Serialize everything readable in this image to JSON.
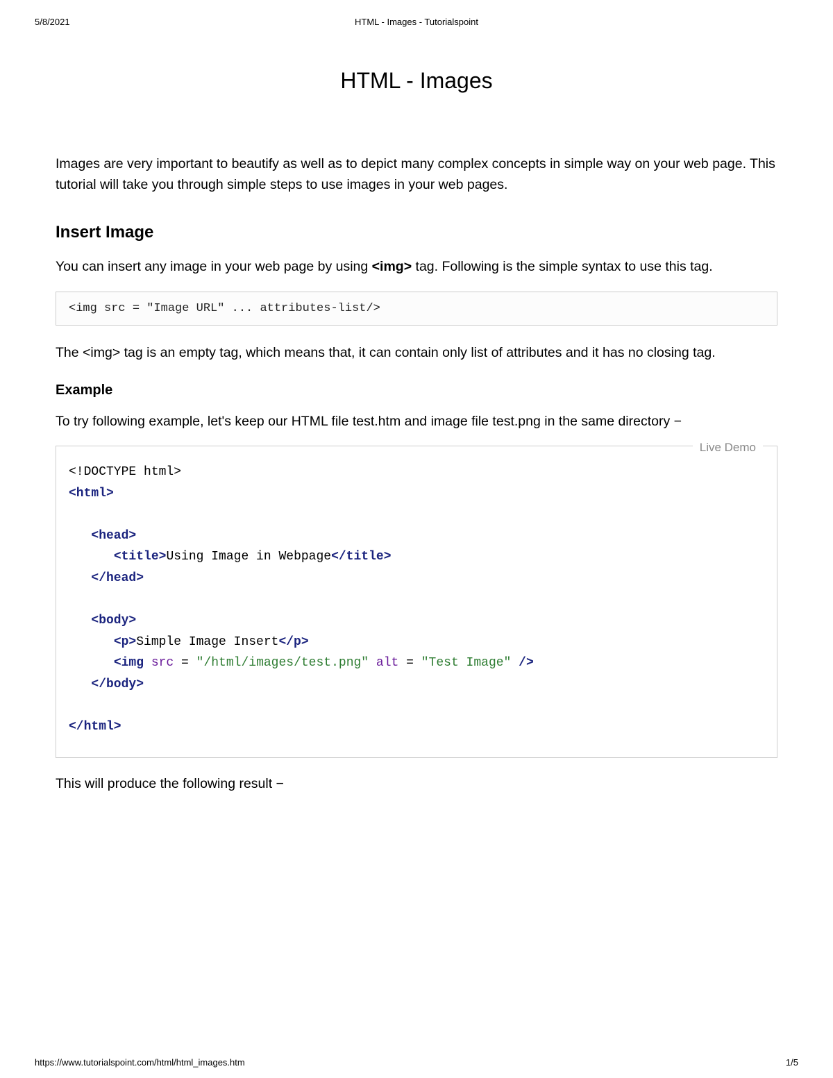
{
  "print_header": {
    "date": "5/8/2021",
    "title": "HTML - Images - Tutorialspoint"
  },
  "page_title": "HTML - Images",
  "intro": "Images are very important to beautify as well as to depict many complex concepts in simple way on your web page. This tutorial will take you through simple steps to use images in your web pages.",
  "section1": {
    "heading": "Insert Image",
    "para1_before": "You can insert any image in your web page by using ",
    "para1_tag": "<img>",
    "para1_after": " tag. Following is the simple syntax to use this tag.",
    "code1": "<img src = \"Image URL\" ... attributes-list/>",
    "para2": "The <img> tag is an empty tag, which means that, it can contain only list of attributes and it has no closing tag."
  },
  "example": {
    "heading": "Example",
    "para": "To try following example, let's keep our HTML file test.htm and image file test.png in the same directory −",
    "live_demo_label": "Live Demo",
    "code": {
      "l1_doctype": "<!DOCTYPE html>",
      "l2_html_open": "<html>",
      "l3_head_open": "<head>",
      "l4_title_open": "<title>",
      "l4_title_text": "Using Image in Webpage",
      "l4_title_close": "</title>",
      "l5_head_close": "</head>",
      "l6_body_open": "<body>",
      "l7_p_open": "<p>",
      "l7_p_text": "Simple Image Insert",
      "l7_p_close": "</p>",
      "l8_img_open": "<img",
      "l8_src_attr": " src",
      "l8_eq1": " = ",
      "l8_src_val": "\"/html/images/test.png\"",
      "l8_alt_attr": " alt",
      "l8_eq2": " = ",
      "l8_alt_val": "\"Test Image\"",
      "l8_close": " />",
      "l9_body_close": "</body>",
      "l10_html_close": "</html>"
    },
    "result_para": "This will produce the following result −"
  },
  "print_footer": {
    "url": "https://www.tutorialspoint.com/html/html_images.htm",
    "page": "1/5"
  }
}
